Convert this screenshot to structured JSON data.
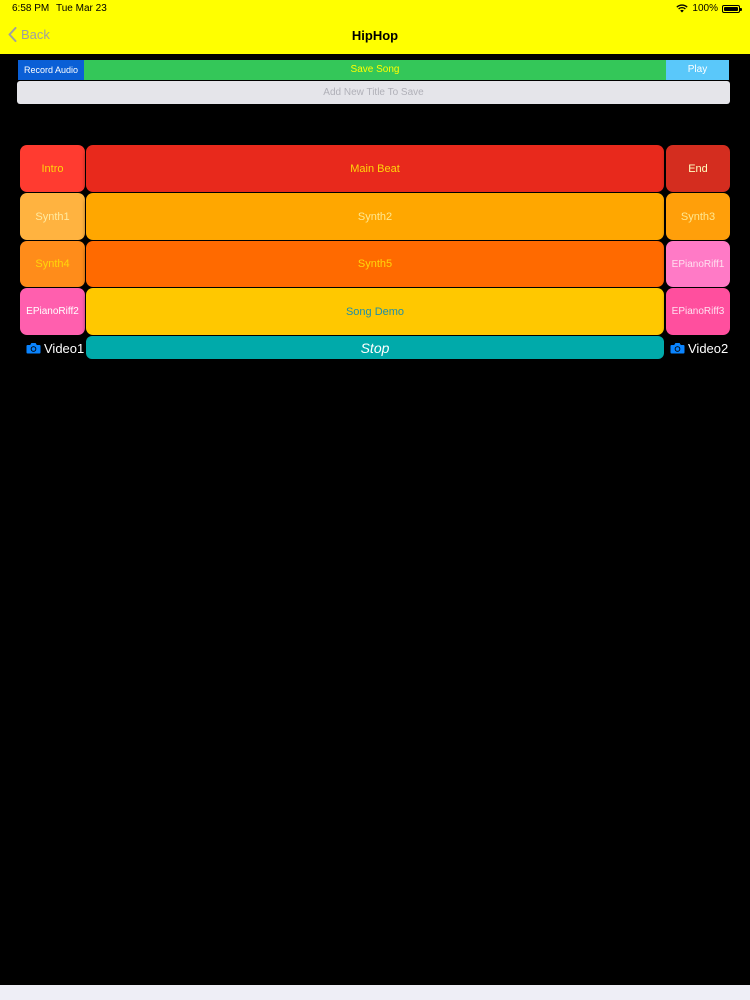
{
  "status": {
    "time": "6:58 PM",
    "date": "Tue Mar 23",
    "battery": "100%",
    "battery_level": 1.0,
    "icons": [
      "wifi-icon",
      "battery-icon"
    ]
  },
  "nav": {
    "back_label": "Back",
    "title": "HipHop"
  },
  "toolbar": {
    "record_label": "Record Audio",
    "save_label": "Save Song",
    "play_label": "Play"
  },
  "title_input": {
    "placeholder": "Add New Title To Save",
    "value": ""
  },
  "pads": [
    {
      "label": "Intro",
      "bg": "#ff3b30",
      "fg": "#ffd60a"
    },
    {
      "label": "Main Beat",
      "bg": "#e8291c",
      "fg": "#ffd60a"
    },
    {
      "label": "End",
      "bg": "#d42d1f",
      "fg": "#ffffc0"
    },
    {
      "label": "Synth1",
      "bg": "#ffb340",
      "fg": "#ffeaa0"
    },
    {
      "label": "Synth2",
      "bg": "#ffa700",
      "fg": "#ffe890"
    },
    {
      "label": "Synth3",
      "bg": "#ff9f0a",
      "fg": "#ffe890"
    },
    {
      "label": "Synth4",
      "bg": "#ff8c1a",
      "fg": "#ffd60a"
    },
    {
      "label": "Synth5",
      "bg": "#ff6a00",
      "fg": "#ffd60a"
    },
    {
      "label": "EPianoRiff1",
      "bg": "#ff7ac6",
      "fg": "#ffe0f0"
    },
    {
      "label": "EPianoRiff2",
      "bg": "#ff5fae",
      "fg": "#ffffff"
    },
    {
      "label": "Song Demo",
      "bg": "#ffc800",
      "fg": "#1f8fa8"
    },
    {
      "label": "EPianoRiff3",
      "bg": "#ff4f9e",
      "fg": "#ffe0f0"
    }
  ],
  "controls": {
    "stop_label": "Stop",
    "video1_label": "Video1",
    "video2_label": "Video2"
  },
  "colors": {
    "header": "#ffff00",
    "background": "#000000",
    "accent_blue": "#0a84ff"
  }
}
